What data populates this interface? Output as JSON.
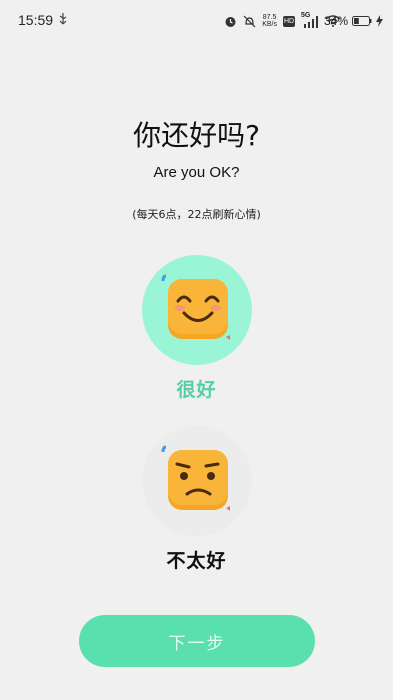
{
  "status_bar": {
    "time": "15:59",
    "net_speed_value": "87.5",
    "net_speed_unit": "KB/s",
    "hd_label": "HD",
    "network_label": "5G",
    "battery_percent": "34%",
    "battery_level": 0.34
  },
  "page": {
    "title": "你还好吗?",
    "subtitle": "Are you OK?",
    "hint": "(每天6点，22点刷新心情)"
  },
  "moods": [
    {
      "label": "很好",
      "selected": true,
      "icon": "smiling-face-icon"
    },
    {
      "label": "不太好",
      "selected": false,
      "icon": "frowning-face-icon"
    }
  ],
  "next_button": {
    "label": "下一步"
  },
  "colors": {
    "background": "#f0f0f0",
    "accent": "#5adfae",
    "selected_circle": "#9af5d6",
    "selected_text": "#55cfa3",
    "face": "#f5a623"
  }
}
